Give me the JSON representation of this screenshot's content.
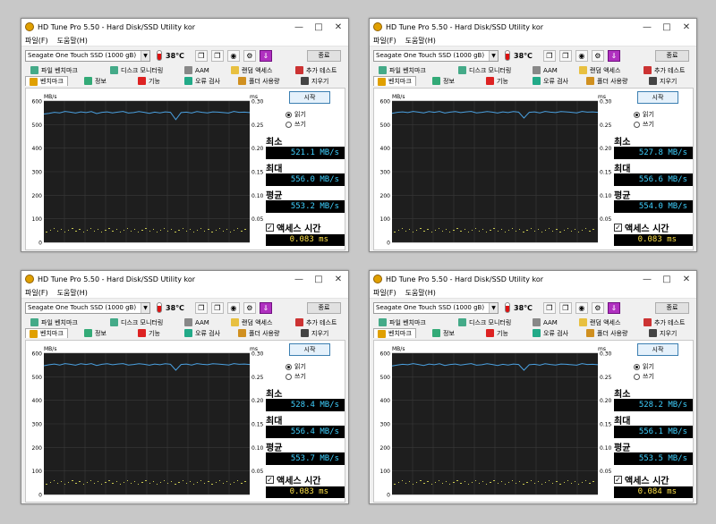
{
  "colors": {
    "window_bg": "#f0f0f0",
    "plot_bg": "#1e1e1e",
    "grid": "#3a3a3a",
    "read_line": "#4aa0e0",
    "access_points": "#c8c850",
    "value_text": "#3fd0ff",
    "access_text": "#ffe24a"
  },
  "windows": [
    {
      "title": "HD Tune Pro 5.50 - Hard Disk/SSD Utility kor",
      "menu": [
        "파일(F)",
        "도움말(H)"
      ],
      "drive": "Seagate One Touch SSD (1000 gB)",
      "temperature": "38℃",
      "exit_label": "종료",
      "tabs_row1": [
        "파일 벤치마크",
        "디스크 모니터링",
        "AAM",
        "랜덤 액세스",
        "추가 테스트"
      ],
      "tabs_row2": [
        "벤치마크",
        "정보",
        "기능",
        "오류 검사",
        "폴더 사용량",
        "지우기"
      ],
      "start_label": "시작",
      "radio_read": "읽기",
      "radio_write": "쓰기",
      "min_label": "최소",
      "min_value": "521.1 MB/s",
      "max_label": "최대",
      "max_value": "556.0 MB/s",
      "avg_label": "평균",
      "avg_value": "553.2 MB/s",
      "access_label": "액세스 시간",
      "access_value": "0.083 ms",
      "y_unit_left": "MB/s",
      "y_unit_right": "ms"
    },
    {
      "title": "HD Tune Pro 5.50 - Hard Disk/SSD Utility kor",
      "menu": [
        "파일(F)",
        "도움말(H)"
      ],
      "drive": "Seagate One Touch SSD (1000 gB)",
      "temperature": "38℃",
      "exit_label": "종료",
      "tabs_row1": [
        "파일 벤치마크",
        "디스크 모니터링",
        "AAM",
        "랜덤 액세스",
        "추가 테스트"
      ],
      "tabs_row2": [
        "벤치마크",
        "정보",
        "기능",
        "오류 검사",
        "폴더 사용량",
        "지우기"
      ],
      "start_label": "시작",
      "radio_read": "읽기",
      "radio_write": "쓰기",
      "min_label": "최소",
      "min_value": "527.8 MB/s",
      "max_label": "최대",
      "max_value": "556.6 MB/s",
      "avg_label": "평균",
      "avg_value": "554.0 MB/s",
      "access_label": "액세스 시간",
      "access_value": "0.083 ms",
      "y_unit_left": "MB/s",
      "y_unit_right": "ms"
    },
    {
      "title": "HD Tune Pro 5.50 - Hard Disk/SSD Utility kor",
      "menu": [
        "파일(F)",
        "도움말(H)"
      ],
      "drive": "Seagate One Touch SSD (1000 gB)",
      "temperature": "38℃",
      "exit_label": "종료",
      "tabs_row1": [
        "파일 벤치마크",
        "디스크 모니터링",
        "AAM",
        "랜덤 액세스",
        "추가 테스트"
      ],
      "tabs_row2": [
        "벤치마크",
        "정보",
        "기능",
        "오류 검사",
        "폴더 사용량",
        "지우기"
      ],
      "start_label": "시작",
      "radio_read": "읽기",
      "radio_write": "쓰기",
      "min_label": "최소",
      "min_value": "528.4 MB/s",
      "max_label": "최대",
      "max_value": "556.4 MB/s",
      "avg_label": "평균",
      "avg_value": "553.7 MB/s",
      "access_label": "액세스 시간",
      "access_value": "0.083 ms",
      "y_unit_left": "MB/s",
      "y_unit_right": "ms"
    },
    {
      "title": "HD Tune Pro 5.50 - Hard Disk/SSD Utility kor",
      "menu": [
        "파일(F)",
        "도움말(H)"
      ],
      "drive": "Seagate One Touch SSD (1000 gB)",
      "temperature": "38℃",
      "exit_label": "종료",
      "tabs_row1": [
        "파일 벤치마크",
        "디스크 모니터링",
        "AAM",
        "랜덤 액세스",
        "추가 테스트"
      ],
      "tabs_row2": [
        "벤치마크",
        "정보",
        "기능",
        "오류 검사",
        "폴더 사용량",
        "지우기"
      ],
      "start_label": "시작",
      "radio_read": "읽기",
      "radio_write": "쓰기",
      "min_label": "최소",
      "min_value": "528.2 MB/s",
      "max_label": "최대",
      "max_value": "556.1 MB/s",
      "avg_label": "평균",
      "avg_value": "553.5 MB/s",
      "access_label": "액세스 시간",
      "access_value": "0.084 ms",
      "y_unit_left": "MB/s",
      "y_unit_right": "ms"
    }
  ],
  "chart_data": [
    {
      "type": "line",
      "ylim": [
        0,
        600
      ],
      "yticks": [
        0,
        100,
        200,
        300,
        400,
        500,
        600
      ],
      "y2ticks": [
        0.05,
        0.1,
        0.15,
        0.2,
        0.25,
        0.3
      ],
      "series": [
        {
          "values": [
            545,
            548,
            552,
            550,
            556,
            553,
            549,
            554,
            551,
            555,
            547,
            552,
            554,
            550,
            553,
            556,
            549,
            551,
            555,
            552,
            548,
            553,
            550,
            554,
            552,
            521,
            551,
            553,
            549,
            555,
            552,
            550,
            554,
            553,
            551,
            549,
            556,
            552,
            553,
            551
          ]
        }
      ],
      "grid": true
    },
    {
      "type": "line",
      "ylim": [
        0,
        600
      ],
      "yticks": [
        0,
        100,
        200,
        300,
        400,
        500,
        600
      ],
      "y2ticks": [
        0.05,
        0.1,
        0.15,
        0.2,
        0.25,
        0.3
      ],
      "series": [
        {
          "values": [
            548,
            552,
            554,
            551,
            556,
            553,
            550,
            555,
            552,
            556,
            549,
            553,
            555,
            551,
            554,
            556,
            550,
            552,
            555,
            553,
            549,
            554,
            551,
            555,
            553,
            528,
            552,
            554,
            550,
            556,
            553,
            551,
            555,
            554,
            552,
            550,
            556,
            553,
            554,
            552
          ]
        }
      ],
      "grid": true
    },
    {
      "type": "line",
      "ylim": [
        0,
        600
      ],
      "yticks": [
        0,
        100,
        200,
        300,
        400,
        500,
        600
      ],
      "y2ticks": [
        0.05,
        0.1,
        0.15,
        0.2,
        0.25,
        0.3
      ],
      "series": [
        {
          "values": [
            547,
            551,
            554,
            550,
            556,
            553,
            549,
            555,
            552,
            556,
            548,
            553,
            555,
            551,
            554,
            556,
            550,
            552,
            555,
            553,
            549,
            554,
            551,
            555,
            553,
            528,
            552,
            554,
            550,
            556,
            553,
            551,
            555,
            554,
            552,
            550,
            556,
            553,
            554,
            552
          ]
        }
      ],
      "grid": true
    },
    {
      "type": "line",
      "ylim": [
        0,
        600
      ],
      "yticks": [
        0,
        100,
        200,
        300,
        400,
        500,
        600
      ],
      "y2ticks": [
        0.05,
        0.1,
        0.15,
        0.2,
        0.25,
        0.3
      ],
      "series": [
        {
          "values": [
            546,
            550,
            553,
            551,
            556,
            552,
            548,
            554,
            551,
            555,
            548,
            552,
            554,
            550,
            553,
            556,
            549,
            551,
            555,
            552,
            548,
            553,
            550,
            554,
            552,
            528,
            551,
            553,
            549,
            555,
            552,
            550,
            554,
            553,
            551,
            549,
            556,
            552,
            553,
            551
          ]
        }
      ],
      "grid": true
    }
  ]
}
